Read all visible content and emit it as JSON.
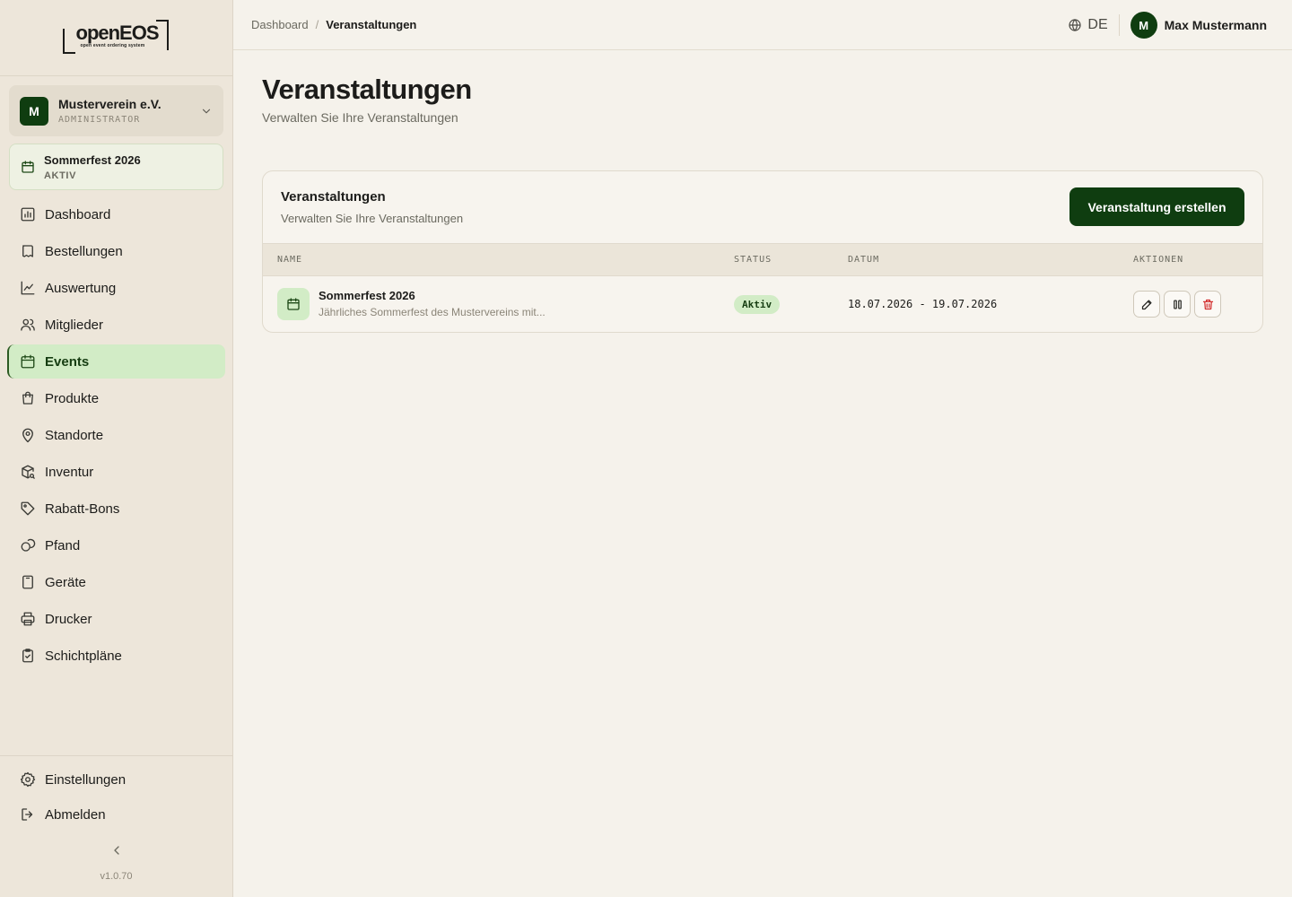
{
  "brand": {
    "name": "openEOS",
    "tagline": "open event ordering system"
  },
  "org": {
    "initial": "M",
    "name": "Musterverein e.V.",
    "role": "ADMINISTRATOR"
  },
  "current_event": {
    "name": "Sommerfest 2026",
    "status": "AKTIV"
  },
  "nav": {
    "items": [
      {
        "label": "Dashboard",
        "icon": "chart-icon"
      },
      {
        "label": "Bestellungen",
        "icon": "book-icon"
      },
      {
        "label": "Auswertung",
        "icon": "line-chart-icon"
      },
      {
        "label": "Mitglieder",
        "icon": "users-icon"
      },
      {
        "label": "Events",
        "icon": "calendar-icon",
        "active": true
      },
      {
        "label": "Produkte",
        "icon": "shopping-bag-icon"
      },
      {
        "label": "Standorte",
        "icon": "map-pin-icon"
      },
      {
        "label": "Inventur",
        "icon": "package-search-icon"
      },
      {
        "label": "Rabatt-Bons",
        "icon": "tag-icon"
      },
      {
        "label": "Pfand",
        "icon": "coins-icon"
      },
      {
        "label": "Geräte",
        "icon": "tablet-icon"
      },
      {
        "label": "Drucker",
        "icon": "printer-icon"
      },
      {
        "label": "Schichtpläne",
        "icon": "clipboard-check-icon"
      }
    ],
    "bottom": [
      {
        "label": "Einstellungen",
        "icon": "gear-icon"
      },
      {
        "label": "Abmelden",
        "icon": "logout-icon"
      }
    ]
  },
  "version": "v1.0.70",
  "breadcrumb": {
    "home": "Dashboard",
    "separator": "/",
    "current": "Veranstaltungen"
  },
  "language": "DE",
  "user": {
    "initial": "M",
    "name": "Max Mustermann"
  },
  "page": {
    "title": "Veranstaltungen",
    "subtitle": "Verwalten Sie Ihre Veranstaltungen"
  },
  "card": {
    "title": "Veranstaltungen",
    "subtitle": "Verwalten Sie Ihre Veranstaltungen",
    "create_label": "Veranstaltung erstellen"
  },
  "table": {
    "headers": [
      "NAME",
      "STATUS",
      "DATUM",
      "AKTIONEN"
    ],
    "rows": [
      {
        "name": "Sommerfest 2026",
        "description": "Jährliches Sommerfest des Mustervereins mit...",
        "status": "Aktiv",
        "date": "18.07.2026 - 19.07.2026"
      }
    ]
  },
  "colors": {
    "accent": "#0f3d10",
    "active_bg": "#d2ecc6",
    "danger": "#d32f2f",
    "background": "#f5f2eb",
    "sidebar": "#ede6da"
  }
}
